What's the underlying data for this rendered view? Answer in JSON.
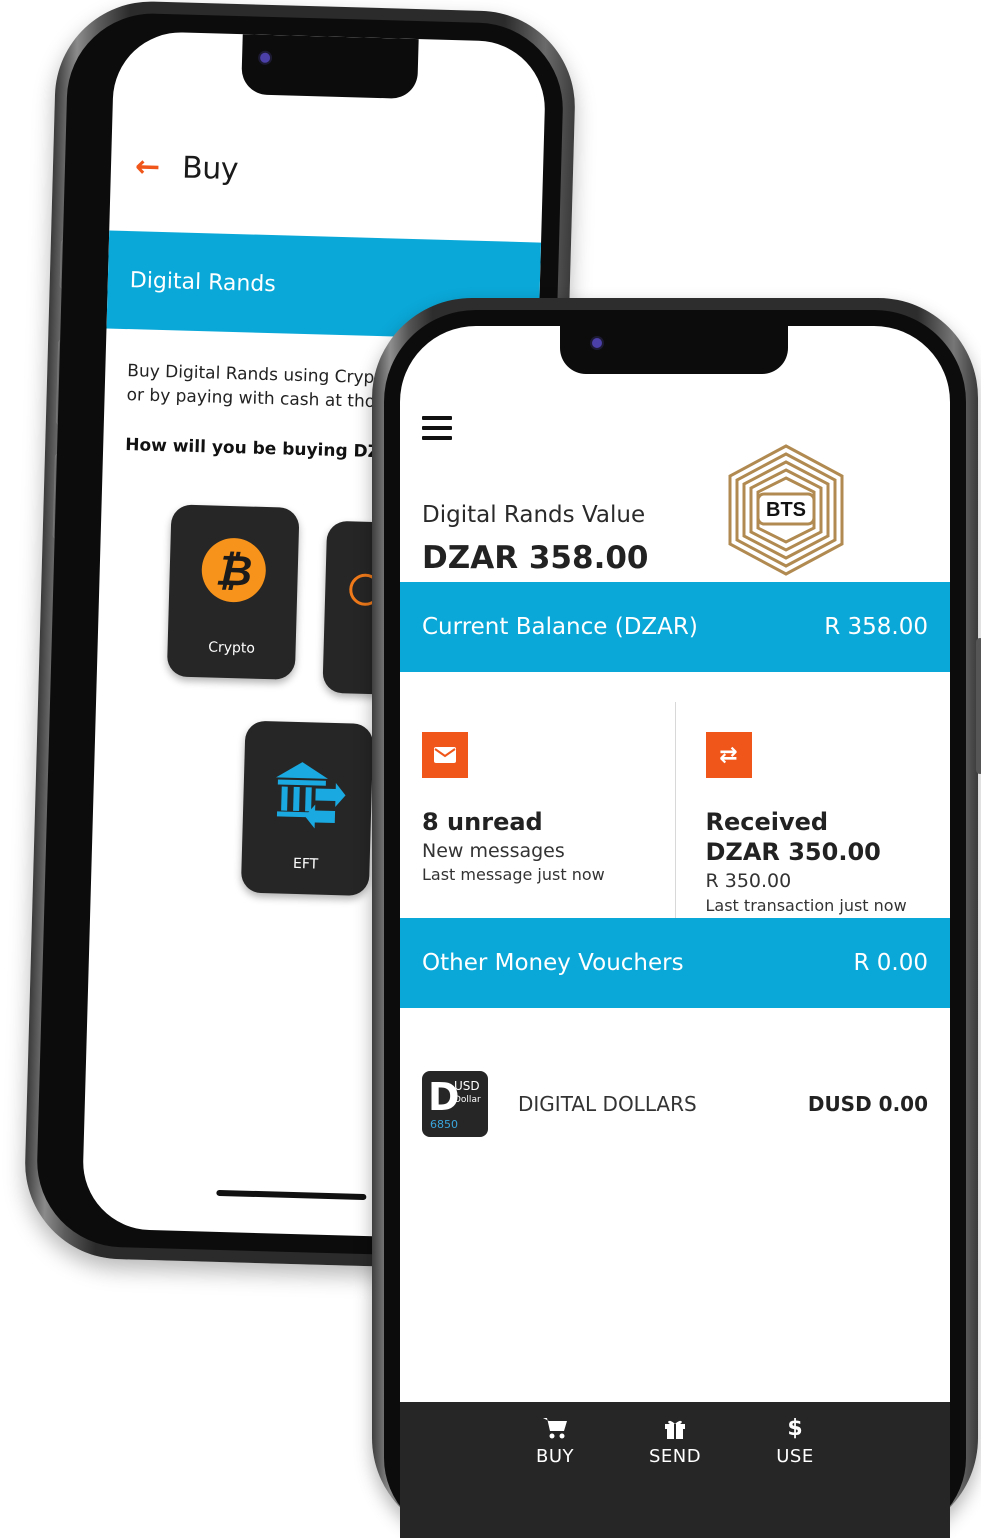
{
  "buy_screen": {
    "title": "Buy",
    "band_title": "Digital Rands",
    "description_line1": "Buy Digital Rands using Crypto, you",
    "description_line2": "or by paying with cash at thousand",
    "question": "How will you be buying DZAR?",
    "options": [
      {
        "label": "Crypto",
        "icon": "bitcoin-icon"
      },
      {
        "label": "EFT",
        "icon": "bank-transfer-icon"
      }
    ]
  },
  "home_screen": {
    "value_label": "Digital Rands Value",
    "value_amount": "DZAR 358.00",
    "logo_text": "BTS",
    "balance": {
      "label": "Current Balance (DZAR)",
      "amount": "R 358.00"
    },
    "messages": {
      "count": "8 unread",
      "label": "New messages",
      "last": "Last message just now"
    },
    "transaction": {
      "title": "Received",
      "amount": "DZAR 350.00",
      "rand_amount": "R 350.00",
      "last": "Last transaction just now"
    },
    "vouchers": {
      "label": "Other Money Vouchers",
      "amount": "R 0.00"
    },
    "voucher_items": [
      {
        "logo_letter": "D",
        "logo_code": "USD",
        "logo_sub": "Dollar",
        "logo_num": "6850",
        "name": "DIGITAL DOLLARS",
        "value": "DUSD 0.00"
      }
    ],
    "nav": [
      {
        "label": "BUY",
        "icon": "cart-icon"
      },
      {
        "label": "SEND",
        "icon": "gift-icon"
      },
      {
        "label": "USE",
        "icon": "dollar-icon"
      }
    ]
  },
  "colors": {
    "accent_blue": "#0aa8d8",
    "accent_orange": "#f0561a",
    "dark": "#262626",
    "gold": "#b08a50"
  }
}
